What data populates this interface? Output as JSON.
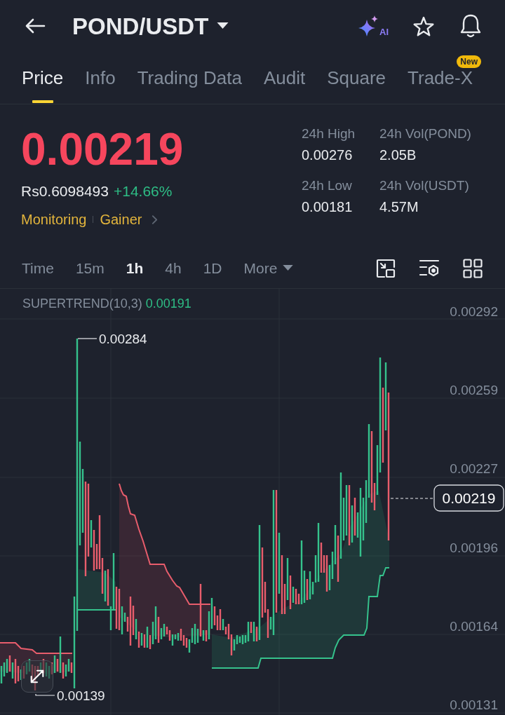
{
  "header": {
    "pair": "POND/USDT",
    "ai_label": "AI"
  },
  "tabs": [
    {
      "label": "Price",
      "selected": true
    },
    {
      "label": "Info",
      "selected": false
    },
    {
      "label": "Trading Data",
      "selected": false
    },
    {
      "label": "Audit",
      "selected": false
    },
    {
      "label": "Square",
      "selected": false
    },
    {
      "label": "Trade-X",
      "selected": false,
      "badge": "New"
    }
  ],
  "ticker": {
    "last_price": "0.00219",
    "price_down": true,
    "converted": "Rs0.6098493",
    "change": "+14.66%",
    "change_positive": true,
    "tags": [
      "Monitoring",
      "Gainer"
    ],
    "stats": [
      {
        "label": "24h High",
        "value": "0.00276"
      },
      {
        "label": "24h Vol(POND)",
        "value": "2.05B"
      },
      {
        "label": "24h Low",
        "value": "0.00181"
      },
      {
        "label": "24h Vol(USDT)",
        "value": "4.57M"
      }
    ]
  },
  "intervals": [
    {
      "label": "Time",
      "selected": false,
      "kind": "option"
    },
    {
      "label": "15m",
      "selected": false,
      "kind": "option"
    },
    {
      "label": "1h",
      "selected": true,
      "kind": "option"
    },
    {
      "label": "4h",
      "selected": false,
      "kind": "option"
    },
    {
      "label": "1D",
      "selected": false,
      "kind": "option"
    },
    {
      "label": "More",
      "selected": false,
      "kind": "menu"
    }
  ],
  "chart": {
    "indicator": {
      "name": "SUPERTREND(10,3)",
      "value": "0.00191"
    },
    "price_axis": [
      "0.00292",
      "0.00259",
      "0.00227",
      "0.00196",
      "0.00164",
      "0.00131"
    ],
    "high_label": "0.00284",
    "low_label": "0.00139",
    "last_price_label": "0.00219"
  }
}
